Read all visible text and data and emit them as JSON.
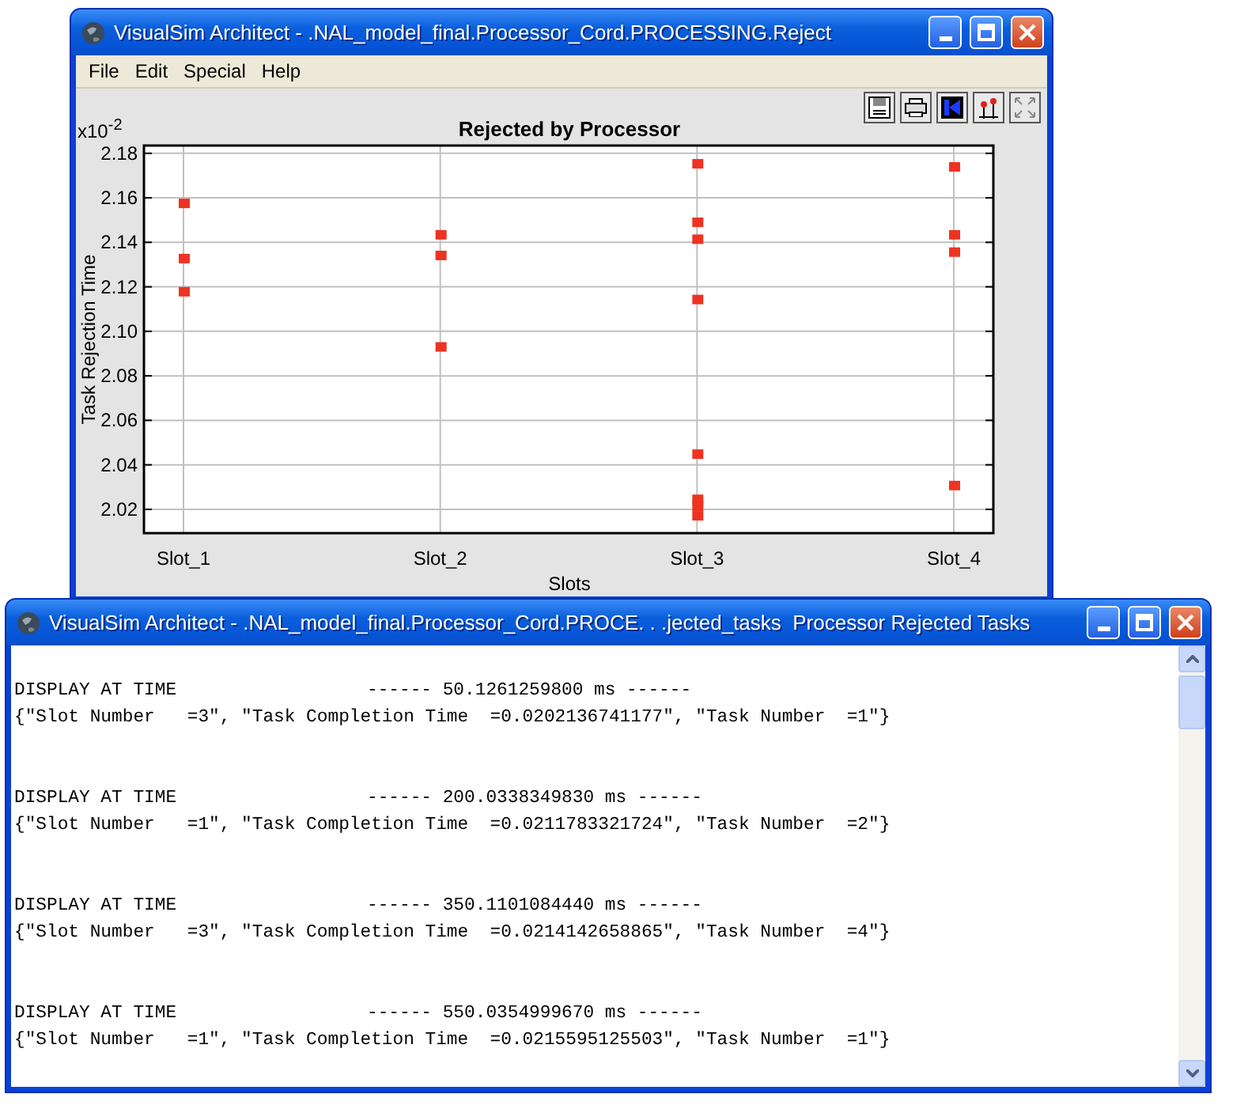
{
  "plot_window": {
    "title": "VisualSim Architect - .NAL_model_final.Processor_Cord.PROCESSING.Reject",
    "menu": [
      "File",
      "Edit",
      "Special",
      "Help"
    ],
    "scale_label": "x10$^{-2}$",
    "chart_data": {
      "type": "scatter",
      "title": "Rejected by Processor",
      "xlabel": "Slots",
      "ylabel": "Task Rejection Time",
      "x": [
        1,
        1,
        1,
        2,
        2,
        2,
        3,
        3,
        3,
        3,
        3,
        3,
        3,
        3,
        4,
        4,
        4,
        4
      ],
      "series": [
        {
          "color": "#ee3322",
          "values": [
            2.1575,
            2.1327,
            2.1178,
            2.1434,
            2.1341,
            2.093,
            2.1753,
            2.149,
            2.1414,
            2.1143,
            2.0448,
            2.0245,
            2.0214,
            2.0171,
            2.1739,
            2.1434,
            2.1356,
            2.0307
          ]
        }
      ],
      "grid": true,
      "xlim": [
        0.846,
        4.154
      ],
      "ylim": [
        2.0093,
        2.1835
      ],
      "xticks": [
        {
          "value": 1,
          "label": "Slot_1"
        },
        {
          "value": 2,
          "label": "Slot_2"
        },
        {
          "value": 3,
          "label": "Slot_3"
        },
        {
          "value": 4,
          "label": "Slot_4"
        }
      ],
      "yticks": [
        {
          "value": 2.02,
          "label": "2.02"
        },
        {
          "value": 2.04,
          "label": "2.04"
        },
        {
          "value": 2.06,
          "label": "2.06"
        },
        {
          "value": 2.08,
          "label": "2.08"
        },
        {
          "value": 2.1,
          "label": "2.10"
        },
        {
          "value": 2.12,
          "label": "2.12"
        },
        {
          "value": 2.14,
          "label": "2.14"
        },
        {
          "value": 2.16,
          "label": "2.16"
        },
        {
          "value": 2.18,
          "label": "2.18"
        }
      ]
    }
  },
  "text_window": {
    "title": "VisualSim Architect - .NAL_model_final.Processor_Cord.PROCE. . .jected_tasks  Processor Rejected Tasks",
    "entries": [
      {
        "header": "DISPLAY AT TIME",
        "time": "------ 50.1261259800 ms ------",
        "record": "{\"Slot Number   =3\", \"Task Completion Time  =0.0202136741177\", \"Task Number  =1\"}"
      },
      {
        "header": "DISPLAY AT TIME",
        "time": "------ 200.0338349830 ms ------",
        "record": "{\"Slot Number   =1\", \"Task Completion Time  =0.0211783321724\", \"Task Number  =2\"}"
      },
      {
        "header": "DISPLAY AT TIME",
        "time": "------ 350.1101084440 ms ------",
        "record": "{\"Slot Number   =3\", \"Task Completion Time  =0.0214142658865\", \"Task Number  =4\"}"
      },
      {
        "header": "DISPLAY AT TIME",
        "time": "------ 550.0354999670 ms ------",
        "record": "{\"Slot Number   =1\", \"Task Completion Time  =0.0215595125503\", \"Task Number  =1\"}"
      }
    ]
  }
}
